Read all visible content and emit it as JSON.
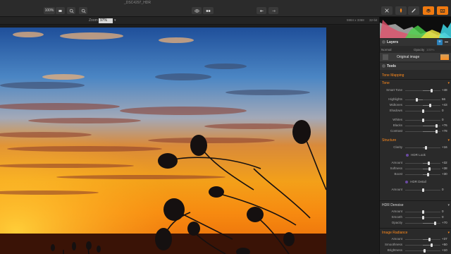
{
  "window": {
    "title": "_DSC4297_HDR"
  },
  "toolbar": {
    "zoom_fit_label": "100%",
    "tools": [
      {
        "name": "move-icon"
      },
      {
        "name": "brush-icon"
      },
      {
        "name": "mask-icon"
      },
      {
        "name": "layers-icon"
      },
      {
        "name": "export-icon"
      }
    ]
  },
  "zoombar": {
    "zoom_label": "Zoom",
    "zoom_value": "97%",
    "dimensions": "5984 x 3368",
    "bit_depth": "32-bit"
  },
  "panel": {
    "layers": {
      "title": "Layers",
      "blend_mode": "Normal",
      "opacity_label": "Opacity",
      "opacity_value": "100%",
      "layer_name": "Original image"
    },
    "tools": {
      "title": "Tools"
    },
    "tone_mapping": {
      "title": "Tone Mapping"
    },
    "tone": {
      "title": "Tone",
      "smart_tone": {
        "label": "Smart Tone",
        "value": "+48",
        "pos": 0.74
      },
      "highlights": {
        "label": "Highlights",
        "value": "66",
        "pos": 0.33
      },
      "midtones": {
        "label": "Midtones",
        "value": "+43",
        "pos": 0.71
      },
      "shadows": {
        "label": "Shadows",
        "value": "0",
        "pos": 0.5
      },
      "whites": {
        "label": "Whites",
        "value": "0",
        "pos": 0.5
      },
      "blacks": {
        "label": "Blacks",
        "value": "+76",
        "pos": 0.88
      },
      "contrast": {
        "label": "Contrast",
        "value": "+78",
        "pos": 0.89
      }
    },
    "structure": {
      "title": "Structure",
      "clarity": {
        "label": "Clarity",
        "value": "+16",
        "pos": 0.58
      },
      "hdr_look_label": "HDR Look",
      "amount": {
        "label": "Amount",
        "value": "+32",
        "pos": 0.66
      },
      "softness": {
        "label": "Softness",
        "value": "+38",
        "pos": 0.69
      },
      "boost": {
        "label": "Boost",
        "value": "+30",
        "pos": 0.65
      },
      "hdr_detail_label": "HDR Detail",
      "detail_amount": {
        "label": "Amount",
        "value": "0",
        "pos": 0.5
      }
    },
    "hdr_denoise": {
      "title": "HDR Denoise",
      "amount": {
        "label": "Amount",
        "value": "0",
        "pos": 0.5
      },
      "smooth": {
        "label": "Smooth",
        "value": "0",
        "pos": 0.5
      },
      "opacity": {
        "label": "Opacity",
        "value": "+70",
        "pos": 0.85
      }
    },
    "image_radiance": {
      "title": "Image Radiance",
      "amount": {
        "label": "Amount",
        "value": "+37",
        "pos": 0.68
      },
      "smoothness": {
        "label": "Smoothness",
        "value": "+50",
        "pos": 0.75
      },
      "brightness": {
        "label": "Brightness",
        "value": "+10",
        "pos": 0.55
      }
    }
  },
  "colors": {
    "accent_orange": "#ff8a1c",
    "panel_bg": "#2a2a2a",
    "toolbar_bg": "#2b2b2b",
    "sky_top": "#2a5da8",
    "sunset_orange": "#f59a16"
  }
}
